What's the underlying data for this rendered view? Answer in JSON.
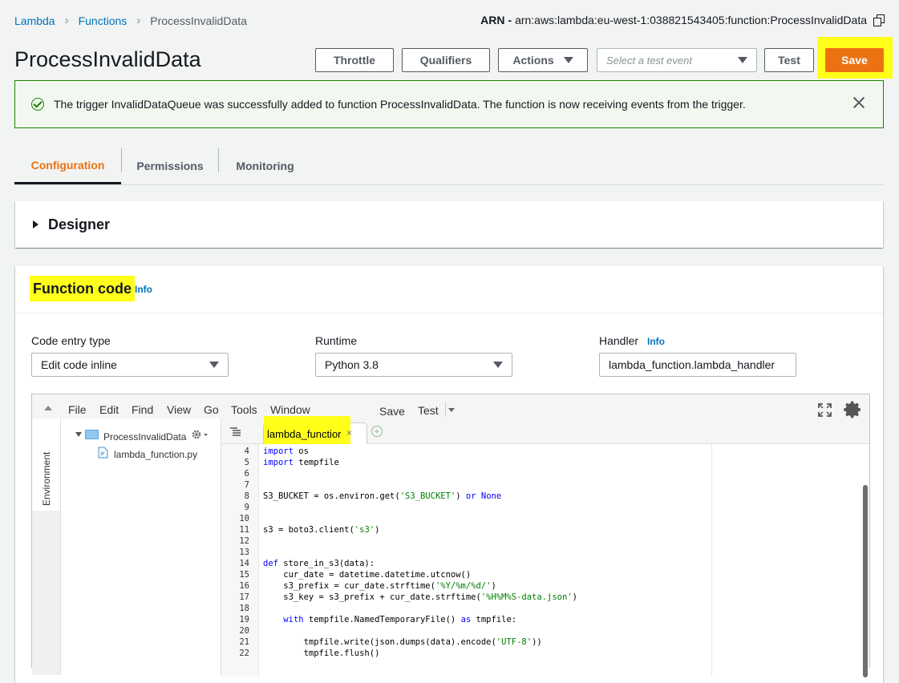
{
  "breadcrumb": {
    "lambda": "Lambda",
    "functions": "Functions",
    "current": "ProcessInvalidData"
  },
  "arn": {
    "label": "ARN -",
    "value": "arn:aws:lambda:eu-west-1:038821543405:function:ProcessInvalidData"
  },
  "page_title": "ProcessInvalidData",
  "toolbar": {
    "throttle": "Throttle",
    "qualifiers": "Qualifiers",
    "actions": "Actions",
    "test_event_placeholder": "Select a test event",
    "test": "Test",
    "save": "Save"
  },
  "flash": {
    "message": "The trigger InvalidDataQueue was successfully added to function ProcessInvalidData. The function is now receiving events from the trigger."
  },
  "tabs": [
    "Configuration",
    "Permissions",
    "Monitoring"
  ],
  "designer": {
    "title": "Designer"
  },
  "function_code": {
    "title": "Function code",
    "info": "Info",
    "code_entry_label": "Code entry type",
    "code_entry_value": "Edit code inline",
    "runtime_label": "Runtime",
    "runtime_value": "Python 3.8",
    "handler_label": "Handler",
    "handler_info": "Info",
    "handler_value": "lambda_function.lambda_handler"
  },
  "editor": {
    "menu": [
      "File",
      "Edit",
      "Find",
      "View",
      "Go",
      "Tools",
      "Window"
    ],
    "save": "Save",
    "test": "Test",
    "environment_label": "Environment",
    "folder": "ProcessInvalidData",
    "file": "lambda_function.py",
    "open_tab": "lambda_functior",
    "line_numbers": [
      "4",
      "5",
      "6",
      "7",
      "8",
      "9",
      "10",
      "11",
      "12",
      "13",
      "14",
      "15",
      "16",
      "17",
      "18",
      "19",
      "20",
      "21",
      "22"
    ]
  },
  "colors": {
    "accent_orange": "#ec7211",
    "link_blue": "#0073bb",
    "success_green": "#1d8102",
    "highlight": "#ffff1a"
  }
}
